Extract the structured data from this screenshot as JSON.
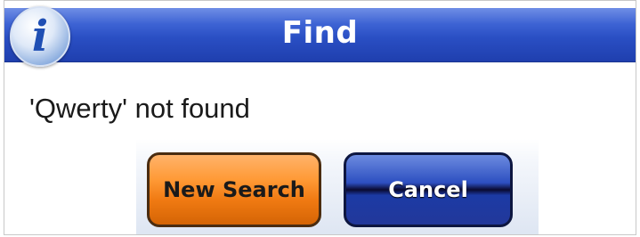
{
  "dialog": {
    "title": "Find",
    "icon": "info-icon",
    "icon_glyph": "i",
    "message": "'Qwerty' not found"
  },
  "buttons": {
    "new_search_label": "New Search",
    "cancel_label": "Cancel"
  },
  "colors": {
    "titlebar": "#2a4fc4",
    "new_search_button": "#ff9a36",
    "cancel_button": "#2d4fc0"
  }
}
